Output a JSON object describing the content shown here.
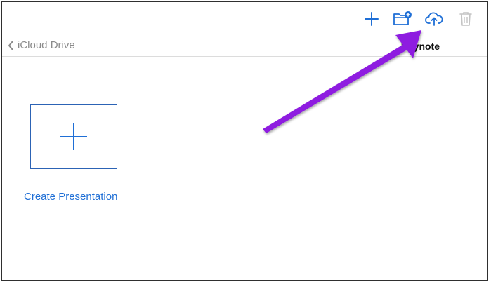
{
  "toolbar": {
    "icons": [
      "plus-icon",
      "new-folder-icon",
      "cloud-upload-icon",
      "trash-icon"
    ]
  },
  "nav": {
    "back_label": "iCloud Drive",
    "title": "Keynote"
  },
  "main": {
    "create_label": "Create Presentation"
  },
  "colors": {
    "accent": "#1f6fd6",
    "tile_border": "#2c63b5",
    "disabled": "#c4c4c4",
    "annotation_arrow": "#8e1fe0"
  }
}
